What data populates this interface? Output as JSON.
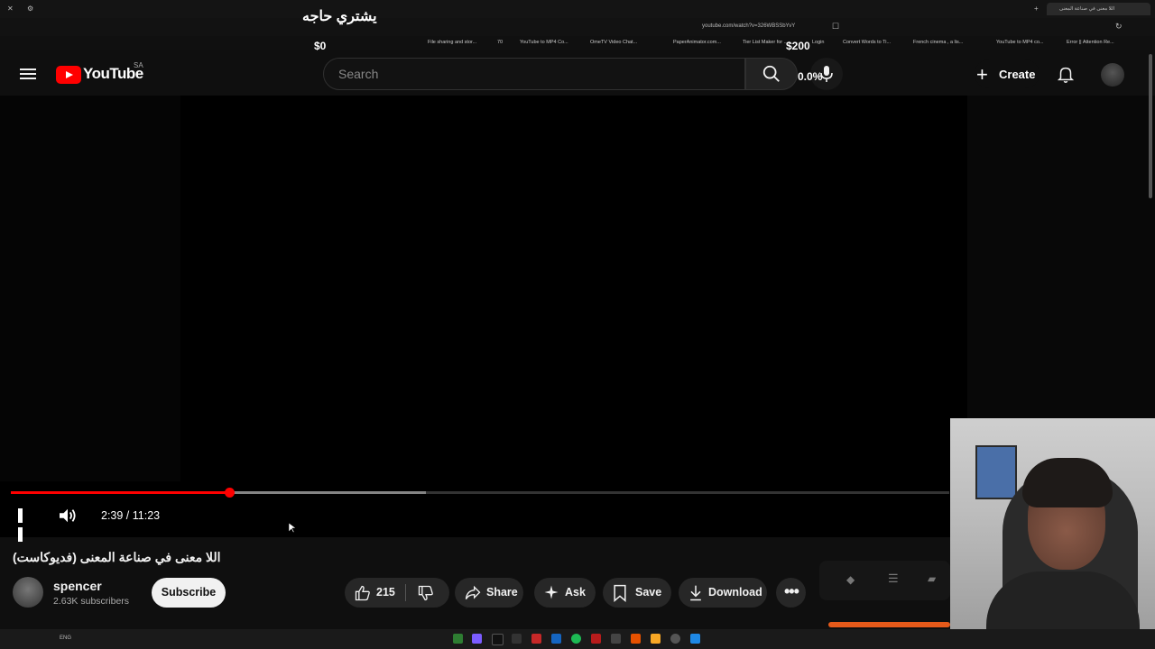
{
  "browser": {
    "address": "youtube.com/watch?v=326WBSSbYvY",
    "active_tab_title": "اللا معنى في صناعة المعنى",
    "bookmarks": [
      "File sharing and stor...",
      "70",
      "YouTube to MP4 Co...",
      "OmeTV Video Chat...",
      "PaperAnimator.com...",
      "Tier List Maker for ...",
      "Login",
      "Convert Words to Ti...",
      "French cinema , a lis...",
      "YouTube to MP4 co...",
      "Error || Attention Re..."
    ]
  },
  "overlays": {
    "arabic_heading": "يشتري حاجه",
    "balance_left": "$0",
    "balance_right": "$200",
    "percent": "0.0%"
  },
  "header": {
    "logo_text": "YouTube",
    "region": "SA",
    "search_placeholder": "Search",
    "create_label": "Create"
  },
  "player": {
    "time": "2:39 / 11:23",
    "progress": 0.2329,
    "buffered": 0.4423
  },
  "video": {
    "title": "اللا معنى في صناعة المعنى (فديوكاست)",
    "channel": "spencer",
    "subscribers": "2.63K subscribers",
    "subscribe_label": "Subscribe",
    "likes": "215",
    "share_label": "Share",
    "ask_label": "Ask",
    "save_label": "Save",
    "download_label": "Download"
  },
  "taskbar": {
    "language": "ENG"
  },
  "colors": {
    "accent": "#ff0000",
    "background": "#0f0f0f",
    "pill": "#272727"
  }
}
